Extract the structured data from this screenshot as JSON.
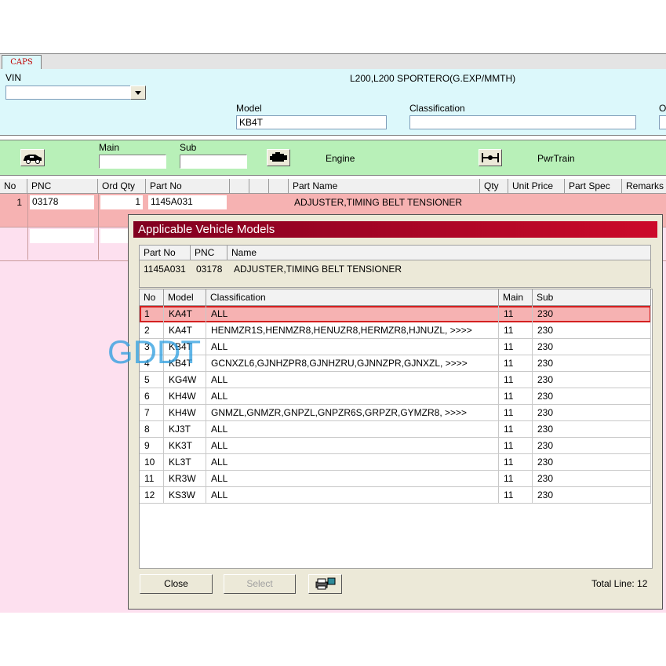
{
  "app": {
    "tab_label": "CAPS",
    "vin_label": "VIN",
    "vin_value": "",
    "title_text": "L200,L200 SPORTERO(G.EXP/MMTH)",
    "model_label": "Model",
    "model_value": "KB4T",
    "classification_label": "Classification",
    "classification_value": "",
    "cut_label": "O"
  },
  "nav": {
    "main_label": "Main",
    "sub_label": "Sub",
    "engine_label": "Engine",
    "pwrtrain_label": "PwrTrain"
  },
  "parts_table": {
    "headers": [
      "No",
      "PNC",
      "Ord Qty",
      "Part No",
      "",
      "",
      "",
      "Part Name",
      "Qty",
      "Unit Price",
      "Part Spec",
      "Remarks"
    ],
    "row": {
      "no": "1",
      "pnc": "03178",
      "ord_qty": "1",
      "part_no": "1145A031",
      "part_name": "ADJUSTER,TIMING BELT TENSIONER"
    }
  },
  "watermark": "GDDT",
  "dialog": {
    "title": "Applicable Vehicle Models",
    "info_headers": [
      "Part No",
      "PNC",
      "Name"
    ],
    "info": {
      "part_no": "1145A031",
      "pnc": "03178",
      "name": "ADJUSTER,TIMING BELT TENSIONER"
    },
    "columns": [
      "No",
      "Model",
      "Classification",
      "Main",
      "Sub"
    ],
    "rows": [
      [
        "1",
        "KA4T",
        "ALL",
        "11",
        "230"
      ],
      [
        "2",
        "KA4T",
        "HENMZR1S,HENMZR8,HENUZR8,HERMZR8,HJNUZL,  >>>>",
        "11",
        "230"
      ],
      [
        "3",
        "KB4T",
        "ALL",
        "11",
        "230"
      ],
      [
        "4",
        "KB4T",
        "GCNXZL6,GJNHZPR8,GJNHZRU,GJNNZPR,GJNXZL,  >>>>",
        "11",
        "230"
      ],
      [
        "5",
        "KG4W",
        "ALL",
        "11",
        "230"
      ],
      [
        "6",
        "KH4W",
        "ALL",
        "11",
        "230"
      ],
      [
        "7",
        "KH4W",
        "GNMZL,GNMZR,GNPZL,GNPZR6S,GRPZR,GYMZR8,  >>>>",
        "11",
        "230"
      ],
      [
        "8",
        "KJ3T",
        "ALL",
        "11",
        "230"
      ],
      [
        "9",
        "KK3T",
        "ALL",
        "11",
        "230"
      ],
      [
        "10",
        "KL3T",
        "ALL",
        "11",
        "230"
      ],
      [
        "11",
        "KR3W",
        "ALL",
        "11",
        "230"
      ],
      [
        "12",
        "KS3W",
        "ALL",
        "11",
        "230"
      ]
    ],
    "close_label": "Close",
    "select_label": "Select",
    "total_label": "Total Line: 12"
  },
  "colors": {
    "top_panel_bg": "#dcf8fb",
    "nav_bar_bg": "#b8f0b8",
    "grid_bg": "#fde0ef",
    "selected_row_bg": "#f6b2b2",
    "dialog_title_start": "#800020",
    "dialog_title_end": "#cc0a2a",
    "watermark": "#2a9de0"
  }
}
